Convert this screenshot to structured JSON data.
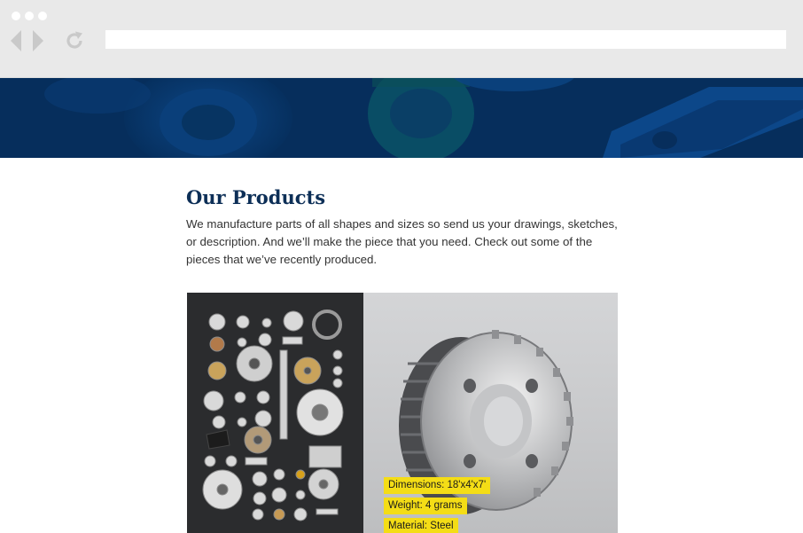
{
  "browser": {
    "url": ""
  },
  "main": {
    "title": "Our Products",
    "intro": "We manufacture parts of all shapes and sizes so send us your drawings, sketches, or description. And we’ll make the piece that you need. Check out some of the pieces that we’ve recently produced."
  },
  "product": {
    "specs": {
      "dimensions": "Dimensions: 18'x4'x7'",
      "weight": "Weight: 4 grams",
      "material": "Material: Steel"
    }
  },
  "colors": {
    "hero": "#06305f",
    "title": "#0d2f57",
    "spec_highlight": "#f4dd16"
  }
}
